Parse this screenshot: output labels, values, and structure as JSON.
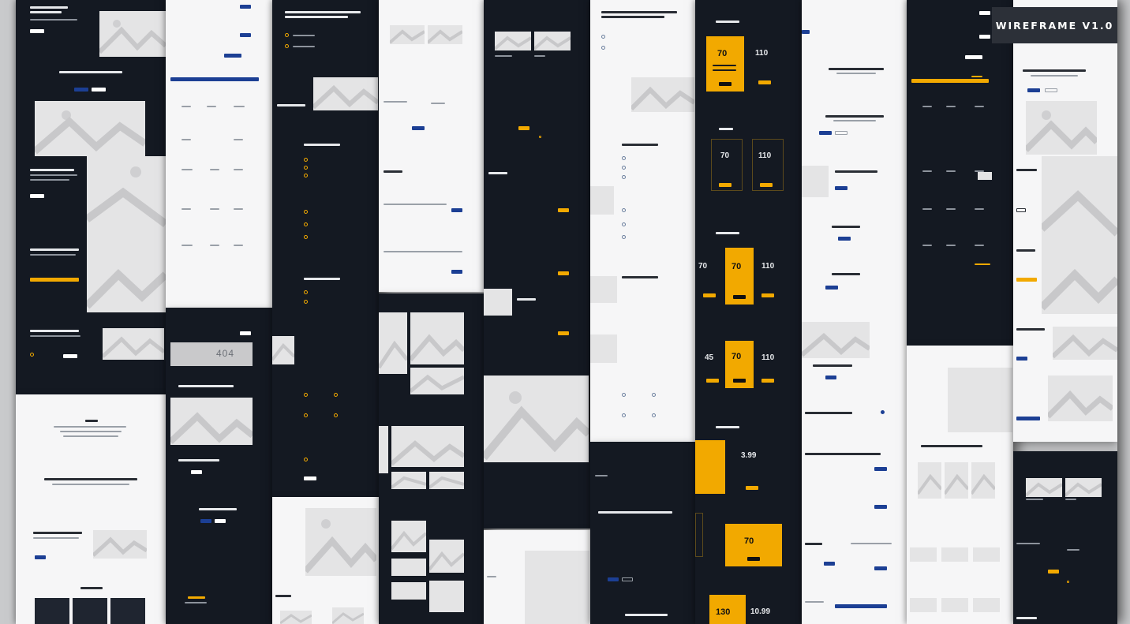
{
  "badge": {
    "label": "WIREFRAME V1.0"
  },
  "page_404": {
    "code": "404"
  },
  "pricing": {
    "price_a": "70",
    "price_b": "110",
    "price_c": "45",
    "price_d": "3.99",
    "price_e": "130",
    "price_f": "10.99"
  },
  "colors": {
    "dark_panel": "#141922",
    "light_panel": "#f6f6f7",
    "accent_yellow": "#f2a900",
    "accent_blue": "#1c3f94",
    "badge_bg": "#2c3038"
  }
}
